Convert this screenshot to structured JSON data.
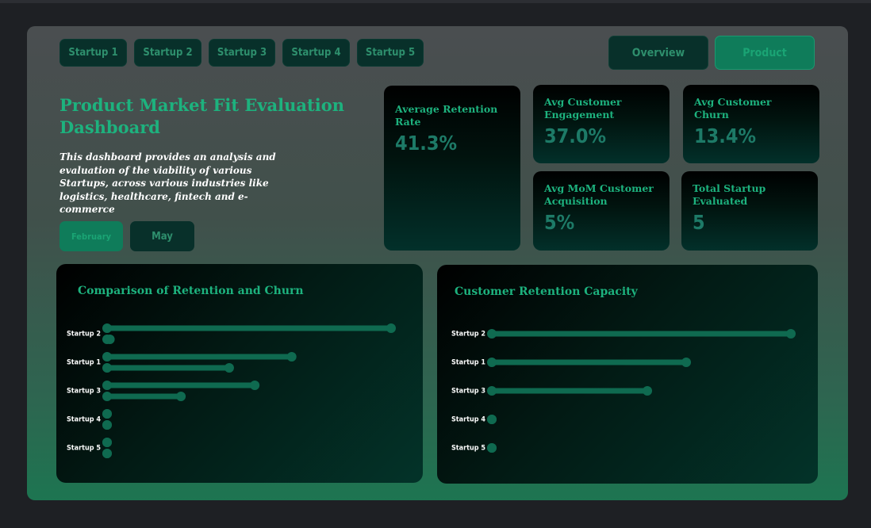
{
  "startups": [
    "Startup 1",
    "Startup 2",
    "Startup 3",
    "Startup 4",
    "Startup 5"
  ],
  "nav": {
    "overview": "Overview",
    "product": "Product"
  },
  "dashboard": {
    "title": "Product Market Fit Evaluation Dashboard",
    "description": "This dashboard provides an analysis and evaluation of the viability of various Startups, across various industries like logistics, healthcare, fintech and e-commerce"
  },
  "months": {
    "feb": "February",
    "may": "May"
  },
  "kpis": {
    "retention": {
      "label": "Average Retention Rate",
      "value": "41.3%"
    },
    "engagement": {
      "label": "Avg Customer Engagement",
      "value": "37.0%"
    },
    "churn": {
      "label": "Avg Customer Churn",
      "value": "13.4%"
    },
    "acquisition": {
      "label": "Avg MoM Customer Acquisition",
      "value": "5%"
    },
    "total": {
      "label": "Total Startup Evaluated",
      "value": "5"
    }
  },
  "colors": {
    "accent": "#1db27e",
    "bar": "#0f6a50",
    "button": "#08302a",
    "active": "#0f7c5a"
  },
  "chart_data": [
    {
      "type": "bar",
      "title": "Comparison of Retention and Churn",
      "categories": [
        "Startup 2",
        "Startup 1",
        "Startup 3",
        "Startup 4",
        "Startup 5"
      ],
      "series": [
        {
          "values": [
            100,
            65,
            52,
            0,
            0
          ]
        },
        {
          "values": [
            1,
            43,
            26,
            0,
            0
          ]
        }
      ],
      "xlim": [
        0,
        100
      ]
    },
    {
      "type": "bar",
      "title": "Customer Retention Capacity",
      "categories": [
        "Startup 2",
        "Startup 1",
        "Startup 3",
        "Startup 4",
        "Startup 5"
      ],
      "values": [
        100,
        65,
        52,
        0,
        0
      ],
      "xlim": [
        0,
        100
      ]
    }
  ]
}
